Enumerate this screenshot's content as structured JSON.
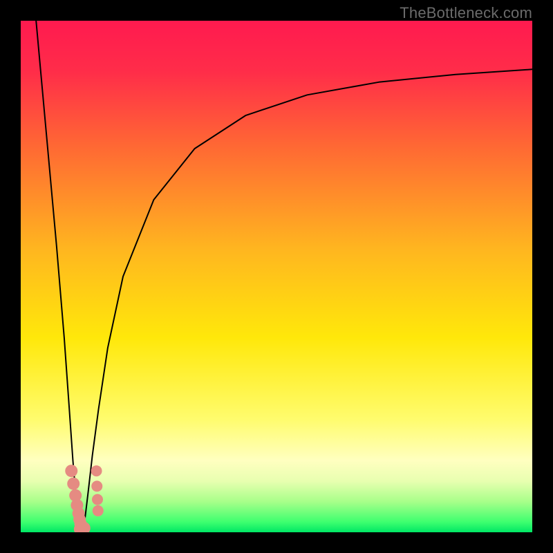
{
  "watermark": "TheBottleneck.com",
  "chart_data": {
    "type": "line",
    "title": "",
    "xlabel": "",
    "ylabel": "",
    "xlim": [
      0,
      100
    ],
    "ylim": [
      0,
      100
    ],
    "background_gradient_stops": [
      {
        "offset": 0.0,
        "color": "#ff1a4f"
      },
      {
        "offset": 0.1,
        "color": "#ff2d49"
      },
      {
        "offset": 0.25,
        "color": "#ff6a33"
      },
      {
        "offset": 0.45,
        "color": "#ffb71f"
      },
      {
        "offset": 0.62,
        "color": "#ffe80a"
      },
      {
        "offset": 0.78,
        "color": "#fffc6e"
      },
      {
        "offset": 0.86,
        "color": "#ffffc0"
      },
      {
        "offset": 0.9,
        "color": "#e8ffb0"
      },
      {
        "offset": 0.94,
        "color": "#a8ff8a"
      },
      {
        "offset": 0.98,
        "color": "#3eff6f"
      },
      {
        "offset": 1.0,
        "color": "#00e765"
      }
    ],
    "series": [
      {
        "name": "left-branch",
        "type": "line",
        "color": "#000000",
        "width": 2,
        "x": [
          3.0,
          5.0,
          7.0,
          8.5,
          9.5,
          10.2,
          10.7,
          11.1,
          11.4,
          11.6
        ],
        "y": [
          100.0,
          78.0,
          56.0,
          38.0,
          24.0,
          14.0,
          8.0,
          4.0,
          2.0,
          0.8
        ]
      },
      {
        "name": "right-branch",
        "type": "line",
        "color": "#000000",
        "width": 2,
        "x": [
          12.2,
          12.6,
          13.2,
          14.0,
          15.2,
          17.0,
          20.0,
          26.0,
          34.0,
          44.0,
          56.0,
          70.0,
          85.0,
          100.0
        ],
        "y": [
          0.8,
          3.0,
          8.0,
          15.0,
          24.0,
          36.0,
          50.0,
          65.0,
          75.0,
          81.5,
          85.5,
          88.0,
          89.5,
          90.5
        ]
      },
      {
        "name": "data-points-left",
        "type": "scatter",
        "color": "#e58b82",
        "radius": 9,
        "x": [
          9.9,
          10.3,
          10.7,
          11.0,
          11.3,
          11.5,
          11.7,
          11.9
        ],
        "y": [
          12.0,
          9.5,
          7.2,
          5.3,
          3.7,
          2.5,
          1.6,
          1.0
        ]
      },
      {
        "name": "data-points-bottom",
        "type": "scatter",
        "color": "#e58b82",
        "radius": 9,
        "x": [
          11.6,
          12.0,
          12.4
        ],
        "y": [
          0.6,
          0.6,
          0.8
        ]
      },
      {
        "name": "data-points-right",
        "type": "scatter",
        "color": "#e58b82",
        "radius": 8,
        "x": [
          14.8,
          14.9,
          15.0,
          15.1
        ],
        "y": [
          12.0,
          9.0,
          6.4,
          4.2
        ]
      }
    ]
  }
}
